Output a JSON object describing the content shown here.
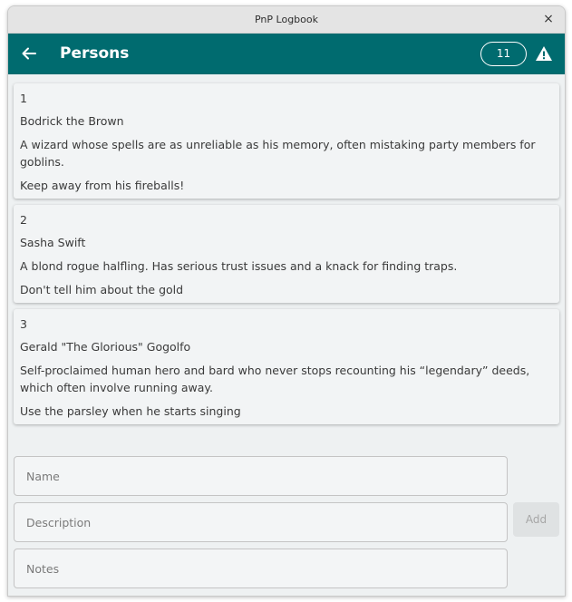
{
  "window": {
    "title": "PnP Logbook",
    "close_glyph": "×"
  },
  "appbar": {
    "back_icon": "arrow-left-icon",
    "title": "Persons",
    "count": "11",
    "warning_icon": "warning-triangle-icon",
    "color": "#006b6f"
  },
  "persons": [
    {
      "id": "1",
      "name": "Bodrick the Brown",
      "description": "A wizard whose spells are as unreliable as his memory, often mistaking party members for goblins.",
      "notes": "Keep away from his fireballs!"
    },
    {
      "id": "2",
      "name": "Sasha Swift",
      "description": "A blond rogue halfling. Has serious trust issues and a knack for finding traps.",
      "notes": "Don't tell him about the gold"
    },
    {
      "id": "3",
      "name": "Gerald \"The Glorious\" Gogolfo",
      "description": "Self-proclaimed human hero and bard who never stops recounting his “legendary” deeds, which often involve running away.",
      "notes": "Use the parsley when he starts singing"
    }
  ],
  "form": {
    "name_placeholder": "Name",
    "description_placeholder": "Description",
    "notes_placeholder": "Notes",
    "add_label": "Add"
  }
}
